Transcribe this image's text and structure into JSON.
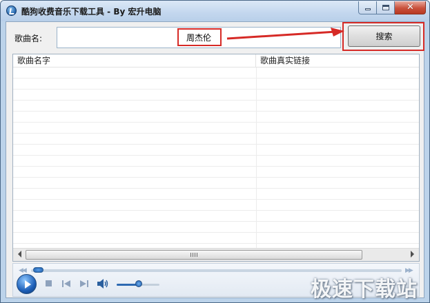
{
  "window": {
    "title": "酷狗收费音乐下载工具 - By 宏升电脑",
    "icon": "kugou-app-icon",
    "controls": {
      "minimize": "minimize-icon",
      "maximize": "maximize-icon",
      "close": "close-icon"
    }
  },
  "search": {
    "label": "歌曲名:",
    "value": "周杰伦",
    "placeholder": "",
    "button_label": "搜索"
  },
  "annotations": {
    "highlight_color": "#d62a26"
  },
  "table": {
    "columns": [
      "歌曲名字",
      "歌曲真实链接"
    ],
    "rows": []
  },
  "player": {
    "progress": 0.0,
    "volume": 0.55,
    "icons": [
      "play-icon",
      "stop-icon",
      "previous-icon",
      "next-icon",
      "volume-icon"
    ]
  },
  "watermark": {
    "text": "极速下载站"
  },
  "colors": {
    "titlebar": "#c3d7ee",
    "close_button": "#c8503b",
    "accent": "#1d5fb8"
  }
}
